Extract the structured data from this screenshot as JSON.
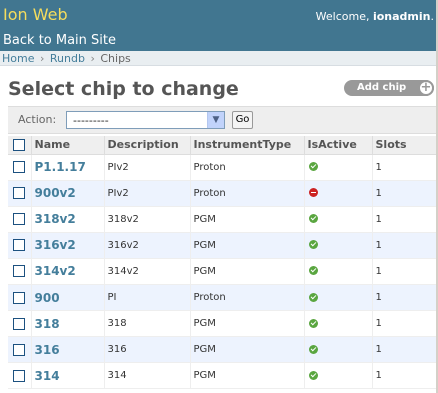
{
  "header": {
    "site_name": "Ion Web",
    "welcome_prefix": "Welcome, ",
    "username": "ionadmin",
    "welcome_suffix": ".",
    "back_link": "Back to Main Site"
  },
  "breadcrumbs": [
    {
      "label": "Home",
      "link": true
    },
    {
      "label": "Rundb",
      "link": true
    },
    {
      "label": "Chips",
      "link": false
    }
  ],
  "breadcrumb_separator": "›",
  "page_title": "Select chip to change",
  "add_button": {
    "label": "Add chip",
    "icon": "plus-icon"
  },
  "actions": {
    "label": "Action:",
    "selected": "---------",
    "go_label": "Go"
  },
  "table": {
    "columns": [
      "Name",
      "Description",
      "InstrumentType",
      "IsActive",
      "Slots"
    ],
    "rows": [
      {
        "name": "P1.1.17",
        "description": "PIv2",
        "instrument_type": "Proton",
        "is_active": true,
        "slots": "1"
      },
      {
        "name": "900v2",
        "description": "PIv2",
        "instrument_type": "Proton",
        "is_active": false,
        "slots": "1"
      },
      {
        "name": "318v2",
        "description": "318v2",
        "instrument_type": "PGM",
        "is_active": true,
        "slots": "1"
      },
      {
        "name": "316v2",
        "description": "316v2",
        "instrument_type": "PGM",
        "is_active": true,
        "slots": "1"
      },
      {
        "name": "314v2",
        "description": "314v2",
        "instrument_type": "PGM",
        "is_active": true,
        "slots": "1"
      },
      {
        "name": "900",
        "description": "PI",
        "instrument_type": "Proton",
        "is_active": true,
        "slots": "1"
      },
      {
        "name": "318",
        "description": "318",
        "instrument_type": "PGM",
        "is_active": true,
        "slots": "1"
      },
      {
        "name": "316",
        "description": "316",
        "instrument_type": "PGM",
        "is_active": true,
        "slots": "1"
      },
      {
        "name": "314",
        "description": "314",
        "instrument_type": "PGM",
        "is_active": true,
        "slots": "1"
      }
    ]
  },
  "icons": {
    "active": "check-circle-icon",
    "inactive": "minus-circle-icon"
  },
  "colors": {
    "header_bg": "#417690",
    "site_name": "#f5dd5d",
    "link": "#447e9b",
    "row_alt": "#edf3fe",
    "active_green": "#5aa640",
    "inactive_red": "#cc2222"
  }
}
